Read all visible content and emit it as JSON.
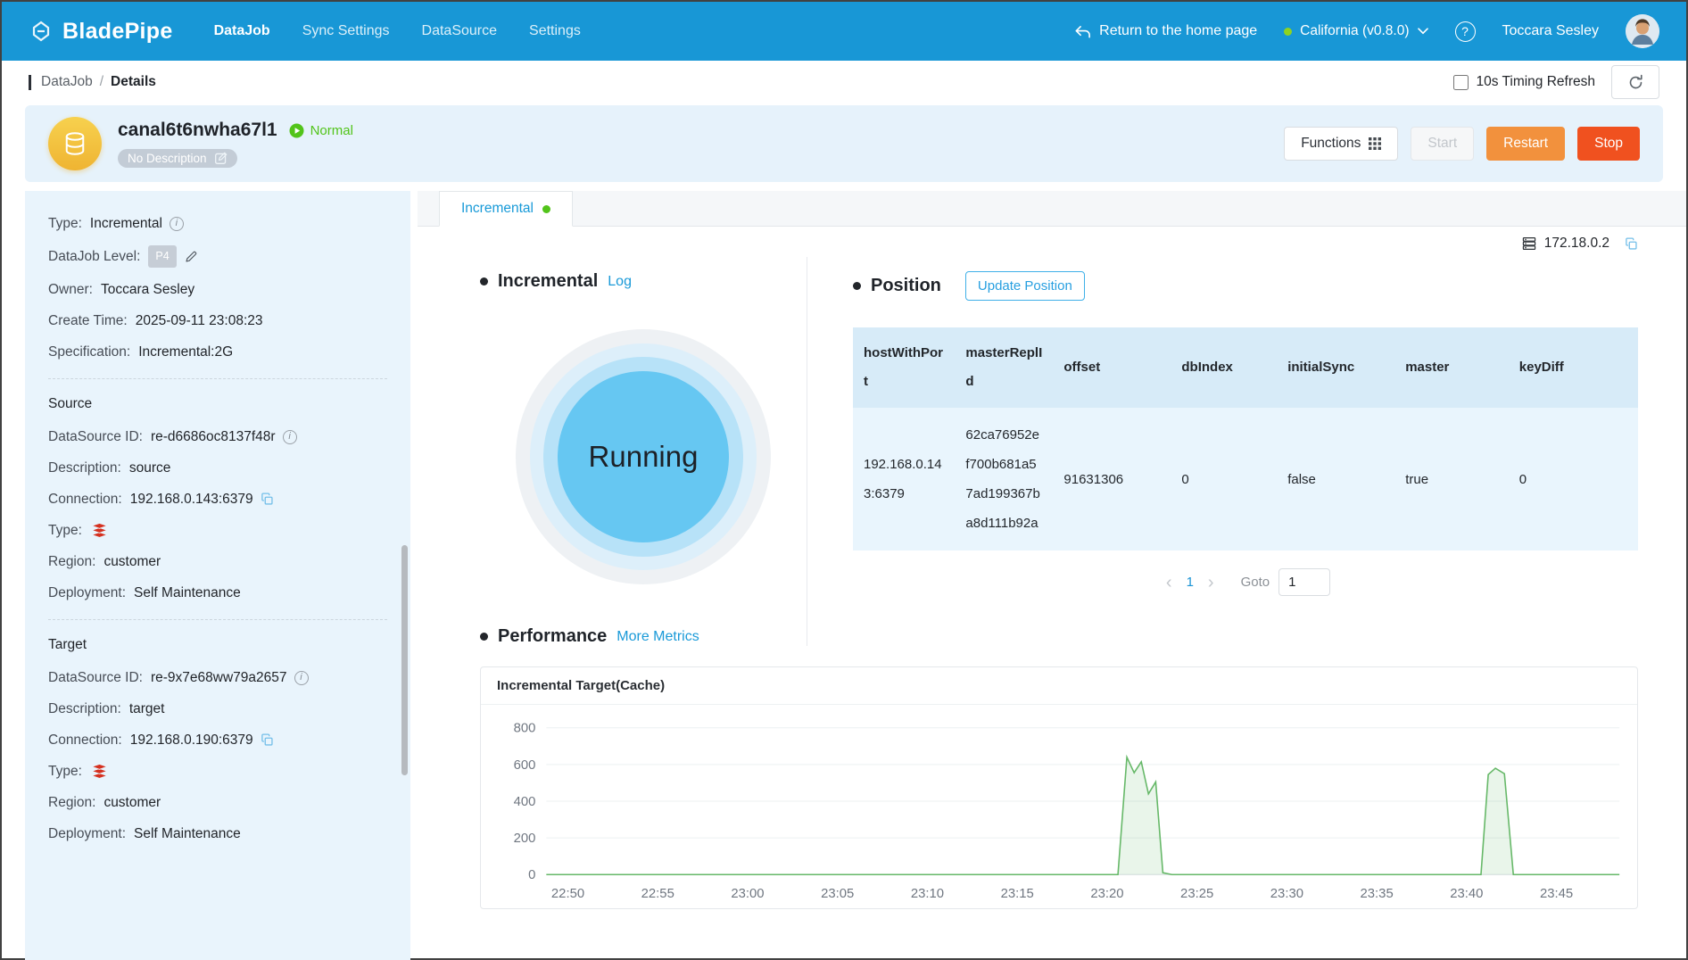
{
  "navbar": {
    "brand": "BladePipe",
    "items": [
      {
        "label": "DataJob"
      },
      {
        "label": "Sync Settings"
      },
      {
        "label": "DataSource"
      },
      {
        "label": "Settings"
      }
    ],
    "return_home": "Return to the home page",
    "region": "California (v0.8.0)",
    "user": "Toccara Sesley"
  },
  "breadcrumb": {
    "parent": "DataJob",
    "separator": "/",
    "current": "Details"
  },
  "toolbar": {
    "timing_refresh_label": "10s Timing Refresh"
  },
  "job": {
    "title": "canal6t6nwha67l1",
    "status": "Normal",
    "description_tag": "No Description",
    "functions_label": "Functions",
    "start_label": "Start",
    "restart_label": "Restart",
    "stop_label": "Stop"
  },
  "details": {
    "type_label": "Type:",
    "type_value": "Incremental",
    "level_label": "DataJob Level:",
    "level_value": "P4",
    "owner_label": "Owner:",
    "owner_value": "Toccara Sesley",
    "create_label": "Create Time:",
    "create_value": "2025-09-11 23:08:23",
    "spec_label": "Specification:",
    "spec_value": "Incremental:2G",
    "source": {
      "heading": "Source",
      "ds_label": "DataSource ID:",
      "ds_value": "re-d6686oc8137f48r",
      "desc_label": "Description:",
      "desc_value": "source",
      "conn_label": "Connection:",
      "conn_value": "192.168.0.143:6379",
      "type_label": "Type:",
      "region_label": "Region:",
      "region_value": "customer",
      "deploy_label": "Deployment:",
      "deploy_value": "Self Maintenance"
    },
    "target": {
      "heading": "Target",
      "ds_label": "DataSource ID:",
      "ds_value": "re-9x7e68ww79a2657",
      "desc_label": "Description:",
      "desc_value": "target",
      "conn_label": "Connection:",
      "conn_value": "192.168.0.190:6379",
      "type_label": "Type:",
      "region_label": "Region:",
      "region_value": "customer",
      "deploy_label": "Deployment:",
      "deploy_value": "Self Maintenance"
    }
  },
  "main": {
    "tab_label": "Incremental",
    "host_ip": "172.18.0.2",
    "incremental": {
      "title": "Incremental",
      "log_link": "Log",
      "state": "Running"
    },
    "position": {
      "title": "Position",
      "update_button": "Update Position",
      "columns": [
        "hostWithPort",
        "masterReplId",
        "offset",
        "dbIndex",
        "initialSync",
        "master",
        "keyDiff"
      ],
      "row": [
        "192.168.0.143:6379",
        "62ca76952ef700b681a57ad199367ba8d111b92a",
        "91631306",
        "0",
        "false",
        "true",
        "0"
      ],
      "pagination": {
        "page": "1",
        "goto_label": "Goto",
        "goto_value": "1"
      }
    },
    "performance": {
      "title": "Performance",
      "more_link": "More Metrics"
    }
  },
  "icons": {
    "info": "i",
    "help": "?",
    "prev": "‹",
    "next": "›"
  },
  "theme": {
    "navbar_blue": "#1897d6",
    "accent_blue": "#1a9ad8",
    "green": "#52c41a",
    "orange": "#f2913d",
    "red": "#f0511f",
    "panel_blue": "#e9f4fc",
    "table_header_blue": "#d7ebf8",
    "chart_green": "#66b868"
  },
  "chart_data": {
    "type": "line",
    "title": "Incremental Target(Cache)",
    "x_axis": "time",
    "x_range": [
      48.8,
      108.5
    ],
    "y_range": [
      0,
      800
    ],
    "y_ticks": [
      0,
      200,
      400,
      600,
      800
    ],
    "x_ticks": [
      {
        "pos": 50,
        "label": "22:50"
      },
      {
        "pos": 55,
        "label": "22:55"
      },
      {
        "pos": 60,
        "label": "23:00"
      },
      {
        "pos": 65,
        "label": "23:05"
      },
      {
        "pos": 70,
        "label": "23:10"
      },
      {
        "pos": 75,
        "label": "23:15"
      },
      {
        "pos": 80,
        "label": "23:20"
      },
      {
        "pos": 85,
        "label": "23:25"
      },
      {
        "pos": 90,
        "label": "23:30"
      },
      {
        "pos": 95,
        "label": "23:35"
      },
      {
        "pos": 100,
        "label": "23:40"
      },
      {
        "pos": 105,
        "label": "23:45"
      }
    ],
    "points": [
      [
        48.8,
        0
      ],
      [
        80.6,
        0
      ],
      [
        81.1,
        640
      ],
      [
        81.5,
        555
      ],
      [
        81.9,
        615
      ],
      [
        82.3,
        440
      ],
      [
        82.7,
        505
      ],
      [
        83.1,
        10
      ],
      [
        83.6,
        0
      ],
      [
        100.8,
        0
      ],
      [
        101.2,
        545
      ],
      [
        101.6,
        580
      ],
      [
        102.1,
        550
      ],
      [
        102.6,
        0
      ],
      [
        108.5,
        0
      ]
    ],
    "grid": true,
    "legend": false,
    "line_color": "#66b868",
    "area_color": "rgba(102,184,104,0.14)"
  }
}
